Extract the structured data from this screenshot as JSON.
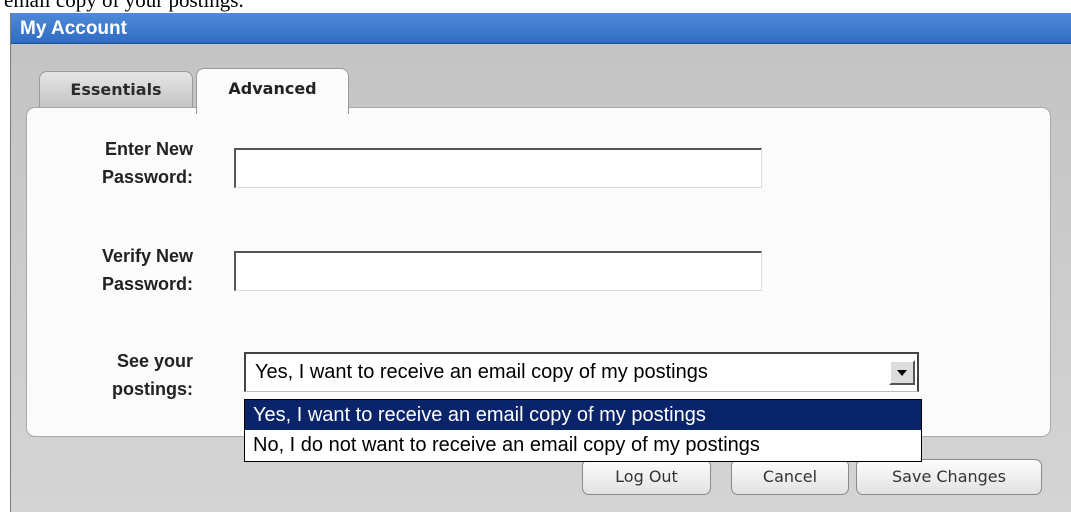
{
  "background_text": "email copy of your postings.",
  "window": {
    "title": "My Account",
    "title_color": "#3a77cc"
  },
  "tabs": [
    {
      "label": "Essentials",
      "active": false
    },
    {
      "label": "Advanced",
      "active": true
    }
  ],
  "form": {
    "new_password": {
      "label_line1": "Enter New",
      "label_line2": "Password:",
      "value": ""
    },
    "verify_password": {
      "label_line1": "Verify New",
      "label_line2": "Password:",
      "value": ""
    },
    "postings": {
      "label_line1": "See your",
      "label_line2": "postings:",
      "selected": "Yes, I want to receive an email copy of my postings",
      "options": [
        "Yes, I want to receive an email copy of my postings",
        "No, I do not want to receive an email copy of my postings"
      ],
      "highlighted_index": 0
    }
  },
  "buttons": {
    "logout": "Log Out",
    "cancel": "Cancel",
    "save": "Save Changes"
  }
}
